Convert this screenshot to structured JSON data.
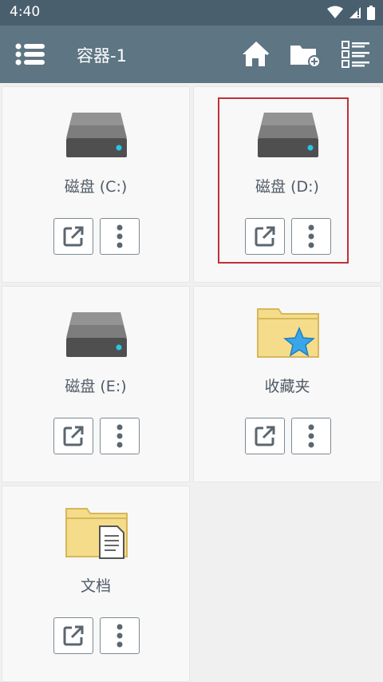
{
  "status": {
    "time": "4:40"
  },
  "appbar": {
    "title": "容器-1"
  },
  "items": [
    {
      "label": "磁盘 (C:)",
      "icon": "drive-icon"
    },
    {
      "label": "磁盘 (D:)",
      "icon": "drive-icon"
    },
    {
      "label": "磁盘 (E:)",
      "icon": "drive-icon"
    },
    {
      "label": "收藏夹",
      "icon": "favorites-folder-icon"
    },
    {
      "label": "文档",
      "icon": "documents-folder-icon"
    }
  ],
  "colors": {
    "appbar": "#5e7583",
    "statusbar": "#4a5f6e",
    "drive_led": "#29c5e6",
    "folder": "#f5dc8a",
    "star": "#3aa6e8",
    "highlight": "#c0303a"
  }
}
